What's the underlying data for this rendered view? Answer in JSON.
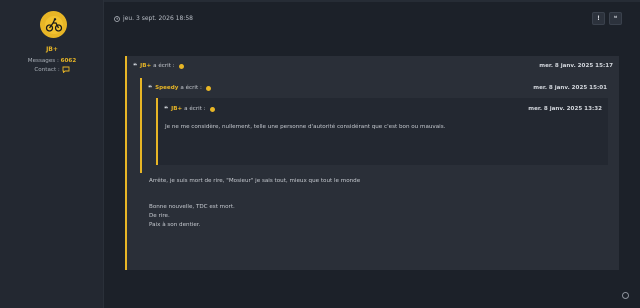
{
  "profile": {
    "username": "JB+",
    "messages_label": "Messages :",
    "messages_value": "6062",
    "contact_label": "Contact :"
  },
  "post": {
    "date": "jeu. 3 sept. 2026 18:58",
    "report_label": "!",
    "quote_label": "❝"
  },
  "quote_outer": {
    "author": "JB+",
    "wrote": "a écrit :",
    "date": "mer. 8 janv. 2025 15:17",
    "lines": [
      "Arrête, je suis mort de rire, \"Mosieur\" je sais tout, mieux que tout le monde",
      "Bonne nouvelle, TDC est mort.",
      "De rire.",
      "Paix à son dentier."
    ]
  },
  "quote_middle": {
    "author": "Speedy",
    "wrote": "a écrit :",
    "date": "mer. 8 janv. 2025 15:01"
  },
  "quote_inner": {
    "author": "JB+",
    "wrote": "a écrit :",
    "date": "mer. 8 janv. 2025 13:32",
    "text": "Je ne me considère, nullement, telle une personne d'autorité considérant que c'est bon ou mauvais."
  },
  "colors": {
    "accent": "#e8b626",
    "background": "#1c2129",
    "panel": "#2a2f38"
  },
  "icons": {
    "avatar": "bike-icon",
    "clock": "clock-icon",
    "contact": "chat-bubble-icon",
    "quote": "quote-icon",
    "arrow": "circle-arrow-icon"
  }
}
